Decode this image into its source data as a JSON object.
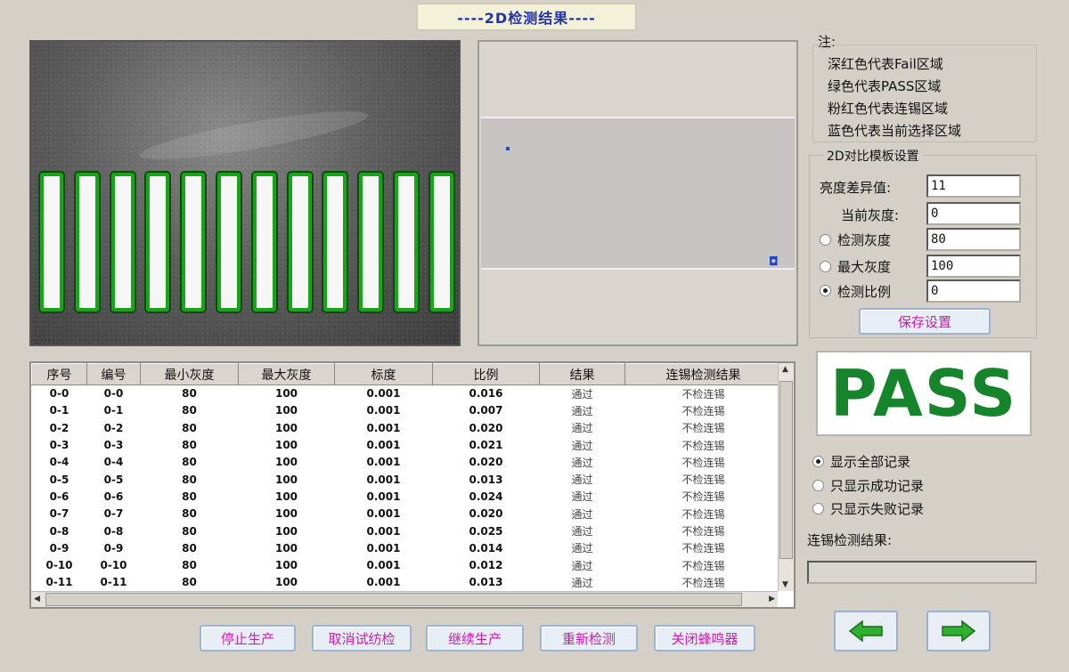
{
  "window": {
    "title": "----2D检测结果----"
  },
  "camera": {
    "slot_count": 12,
    "slot_color": "#19a519"
  },
  "notes": {
    "label": "注:",
    "lines": [
      "深红色代表Fail区域",
      "绿色代表PASS区域",
      "粉红色代表连锡区域",
      "蓝色代表当前选择区域"
    ]
  },
  "settings": {
    "title": "2D对比模板设置",
    "brightness_diff_label": "亮度差异值:",
    "brightness_diff_value": "11",
    "threshold_gray_label": "当前灰度:",
    "threshold_gray_value": "0",
    "detect_gray_label": "检测灰度",
    "detect_gray_value": "80",
    "max_gray_label": "最大灰度",
    "max_gray_value": "100",
    "detect_ratio_label": "检测比例",
    "detect_ratio_value": "0",
    "save_button": "保存设置"
  },
  "result": {
    "status": "PASS",
    "color": "#16842a"
  },
  "table": {
    "columns": [
      "序号",
      "编号",
      "最小灰度",
      "最大灰度",
      "标度",
      "比例",
      "结果",
      "连锡检测结果"
    ],
    "rows": [
      [
        "0-0",
        "0-0",
        "80",
        "100",
        "0.001",
        "0.016",
        "通过",
        "不检连锡"
      ],
      [
        "0-1",
        "0-1",
        "80",
        "100",
        "0.001",
        "0.007",
        "通过",
        "不检连锡"
      ],
      [
        "0-2",
        "0-2",
        "80",
        "100",
        "0.001",
        "0.020",
        "通过",
        "不检连锡"
      ],
      [
        "0-3",
        "0-3",
        "80",
        "100",
        "0.001",
        "0.021",
        "通过",
        "不检连锡"
      ],
      [
        "0-4",
        "0-4",
        "80",
        "100",
        "0.001",
        "0.020",
        "通过",
        "不检连锡"
      ],
      [
        "0-5",
        "0-5",
        "80",
        "100",
        "0.001",
        "0.013",
        "通过",
        "不检连锡"
      ],
      [
        "0-6",
        "0-6",
        "80",
        "100",
        "0.001",
        "0.024",
        "通过",
        "不检连锡"
      ],
      [
        "0-7",
        "0-7",
        "80",
        "100",
        "0.001",
        "0.020",
        "通过",
        "不检连锡"
      ],
      [
        "0-8",
        "0-8",
        "80",
        "100",
        "0.001",
        "0.025",
        "通过",
        "不检连锡"
      ],
      [
        "0-9",
        "0-9",
        "80",
        "100",
        "0.001",
        "0.014",
        "通过",
        "不检连锡"
      ],
      [
        "0-10",
        "0-10",
        "80",
        "100",
        "0.001",
        "0.012",
        "通过",
        "不检连锡"
      ],
      [
        "0-11",
        "0-11",
        "80",
        "100",
        "0.001",
        "0.013",
        "通过",
        "不检连锡"
      ]
    ]
  },
  "filters": {
    "show_all": "显示全部记录",
    "show_success": "只显示成功记录",
    "show_fail": "只显示失败记录",
    "selected": "show_all"
  },
  "review": {
    "label": "连锡检测结果:"
  },
  "buttons": {
    "stop_production": "停止生产",
    "cancel_test": "取消试纺检",
    "continue_production": "继续生产",
    "redetect": "重新检测",
    "close_buzzer": "关闭蜂鸣器"
  },
  "nav": {
    "prev_icon": "arrow-left-icon",
    "next_icon": "arrow-right-icon",
    "arrow_color": "#2fb02f"
  }
}
